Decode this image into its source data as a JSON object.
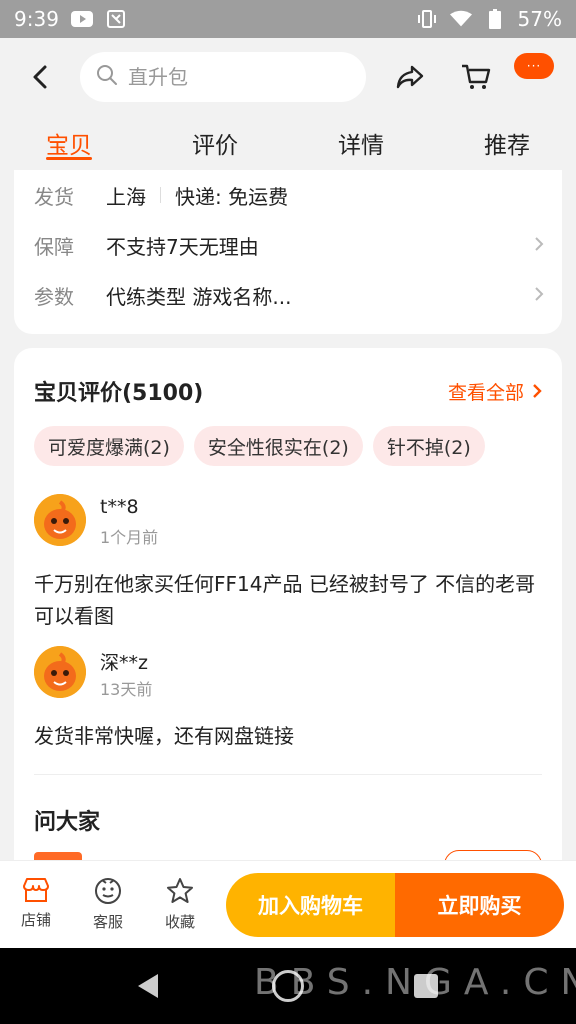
{
  "status_bar": {
    "time": "9:39",
    "battery": "57%",
    "icons": [
      "youtube-icon",
      "app-icon",
      "vibrate-icon",
      "wifi-icon",
      "battery-icon"
    ]
  },
  "header": {
    "search_placeholder": "直升包",
    "more_label": "···"
  },
  "tabs": [
    {
      "label": "宝贝",
      "active": true
    },
    {
      "label": "评价",
      "active": false
    },
    {
      "label": "详情",
      "active": false
    },
    {
      "label": "推荐",
      "active": false
    }
  ],
  "info": {
    "shipping": {
      "label": "发货",
      "location": "上海",
      "delivery": "快递: 免运费"
    },
    "guarantee": {
      "label": "保障",
      "value": "不支持7天无理由"
    },
    "params": {
      "label": "参数",
      "value": "代练类型 游戏名称..."
    }
  },
  "reviews": {
    "title": "宝贝评价(5100)",
    "view_all": "查看全部",
    "tags": [
      "可爱度爆满(2)",
      "安全性很实在(2)",
      "针不掉(2)"
    ],
    "items": [
      {
        "user": "t**8",
        "time": "1个月前",
        "text": "千万别在他家买任何FF14产品 已经被封号了 不信的老哥可以看图"
      },
      {
        "user": "深**z",
        "time": "13天前",
        "text": "发货非常快喔，还有网盘链接"
      }
    ]
  },
  "ask": {
    "title": "问大家"
  },
  "bottom_bar": {
    "shop": "店铺",
    "service": "客服",
    "favorite": "收藏",
    "add_to_cart": "加入购物车",
    "buy_now": "立即购买"
  },
  "watermark": "BBS.NGA.CN",
  "colors": {
    "accent": "#ff5000",
    "cart": "#ffb300",
    "buy": "#ff6a00",
    "tag_bg": "#fde8e8"
  }
}
